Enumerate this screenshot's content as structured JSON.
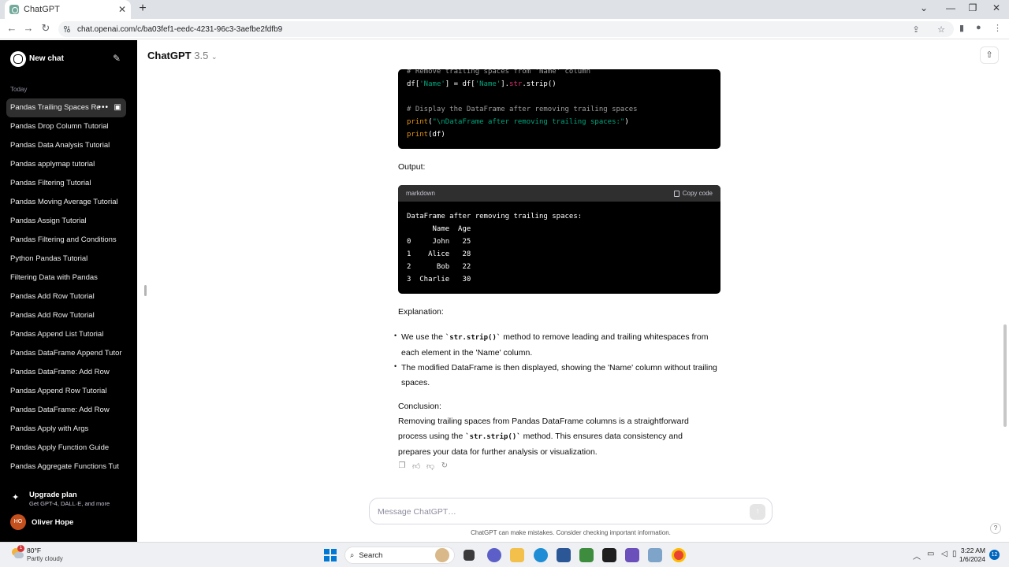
{
  "browser": {
    "tab_title": "ChatGPT",
    "tab_close": "✕",
    "new_tab": "+",
    "url": "chat.openai.com/c/ba03fef1-eedc-4231-96c3-3aefbe2fdfb9",
    "window_controls": [
      "⌄",
      "—",
      "❐",
      "✕"
    ]
  },
  "sidebar": {
    "new_chat": "New chat",
    "section_today": "Today",
    "history": [
      "Pandas Trailing Spaces Re",
      "Pandas Drop Column Tutorial",
      "Pandas Data Analysis Tutorial",
      "Pandas applymap tutorial",
      "Pandas Filtering Tutorial",
      "Pandas Moving Average Tutorial",
      "Pandas Assign Tutorial",
      "Pandas Filtering and Conditions",
      "Python Pandas Tutorial",
      "Filtering Data with Pandas",
      "Pandas Add Row Tutorial",
      "Pandas Add Row Tutorial",
      "Pandas Append List Tutorial",
      "Pandas DataFrame Append Tutor",
      "Pandas DataFrame: Add Row",
      "Pandas Append Row Tutorial",
      "Pandas DataFrame: Add Row",
      "Pandas Apply with Args",
      "Pandas Apply Function Guide",
      "Pandas Aggregate Functions Tut"
    ],
    "upgrade_title": "Upgrade plan",
    "upgrade_sub": "Get GPT-4, DALL·E, and more",
    "user_initials": "HO",
    "user_name": "Oliver Hope"
  },
  "header": {
    "model": "ChatGPT",
    "version": "3.5"
  },
  "code1": {
    "line1": "# Remove trailing spaces from 'Name' column",
    "line2_a": "df[",
    "line2_b": "'Name'",
    "line2_c": "] = df[",
    "line2_d": "'Name'",
    "line2_e": "].",
    "line2_f": "str",
    "line2_g": ".strip()",
    "line3": "# Display the DataFrame after removing trailing spaces",
    "line4_a": "print",
    "line4_b": "(",
    "line4_c": "\"\\nDataFrame after removing trailing spaces:\"",
    "line4_d": ")",
    "line5_a": "print",
    "line5_b": "(df)"
  },
  "output_label": "Output:",
  "code2": {
    "language": "markdown",
    "copy_label": "Copy code",
    "text": "DataFrame after removing trailing spaces:\n      Name  Age\n0     John   25\n1    Alice   28\n2      Bob   22\n3  Charlie   30"
  },
  "explanation_label": "Explanation:",
  "bullet1_a": "We use the ",
  "bullet1_code": "`str.strip()`",
  "bullet1_b": " method to remove leading and trailing whitespaces from each element in the 'Name' column.",
  "bullet2": "The modified DataFrame is then displayed, showing the 'Name' column without trailing spaces.",
  "conclusion_label": "Conclusion:",
  "conclusion_a": "Removing trailing spaces from Pandas DataFrame columns is a straightforward process using the ",
  "conclusion_code": "`str.strip()`",
  "conclusion_b": " method. This ensures data consistency and prepares your data for further analysis or visualization.",
  "composer": {
    "placeholder": "Message ChatGPT…"
  },
  "disclaimer": "ChatGPT can make mistakes. Consider checking important information.",
  "taskbar": {
    "weather_badge": "1",
    "temp": "80°F",
    "condition": "Partly cloudy",
    "search": "Search",
    "time": "3:22 AM",
    "date": "1/6/2024",
    "notifications": "12"
  },
  "colors": {
    "sidebar_bg": "#000000",
    "code_string": "#00a67d",
    "code_keyword": "#e9950c",
    "code_comment": "#9b9b9b"
  }
}
